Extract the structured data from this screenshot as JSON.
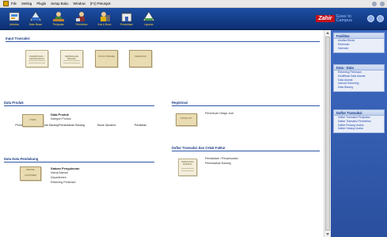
{
  "menubar": {
    "items": [
      "File",
      "Setting",
      "Plugin",
      "Setup Buku",
      "Window",
      "(F1) Petunjuk"
    ]
  },
  "toolbar": {
    "buttons": [
      "Aktivitas",
      "Buku Besar",
      "Penjualan",
      "Pembelian",
      "Kas & Bank",
      "Persediaan",
      "Laporan"
    ],
    "logo_brand": "Zahir",
    "logo_tag_1": "Goes to",
    "logo_tag_2": "Campus"
  },
  "sections": {
    "input_transaksi": "Input Transaksi",
    "data_produk": "Data Produk",
    "registrasi": "Registrasi",
    "daftar_cetak": "Daftar Transaksi dan Cetak Faktur",
    "data_pendukung": "Data Data Pendukung"
  },
  "input_transaksi": {
    "icons": [
      {
        "doc": "PERMINTAAN / PENYESUAIAN",
        "label": "Pemakaian / Penyesuaian Barang"
      },
      {
        "doc": "PEMINDAHAN BARANG",
        "label": "Pemindahan Barang"
      },
      {
        "doc": "STOCK OPNAME",
        "label": "Stock Opname"
      },
      {
        "doc": "PERAKITAN",
        "label": "Perakitan"
      }
    ]
  },
  "data_produk": {
    "doc": "ITEMS",
    "heading": "Data Produk",
    "links": [
      "Kategori Produk"
    ]
  },
  "registrasi": {
    "doc": "PRICE LIST",
    "links": [
      "Penentuan Harga Jual"
    ]
  },
  "daftar_cetak": {
    "doc": "PEMAKAIAN BARANG",
    "links": [
      "Pemakaian / Penyesuaian",
      "Pemindahan Barang"
    ]
  },
  "data_pendukung": {
    "doc": "PROYEK",
    "doc2": "CUSTOMER",
    "heading": "Satuan Pengukuran",
    "links": [
      "Nama Alamat",
      "Departemen",
      "Rekening Perkiraan"
    ]
  },
  "sidebar": {
    "fasilitas": {
      "title": "Fasilitas",
      "links": [
        "Analisa Bisnis",
        "Reminder",
        "Kalender"
      ]
    },
    "data_data": {
      "title": "Data - Data",
      "links": [
        "Rekening Perkiraan",
        "Modifikasi Data Alamat",
        "Data Alamat",
        "Interval Rekening",
        "Data Barang"
      ]
    },
    "daftar_transaksi": {
      "title": "Daftar Transaksi",
      "links": [
        "Daftar Transaksi Penjualan",
        "Daftar Transaksi Pembelian",
        "Daftar Piutang Usaha",
        "Daftar Hutang Usaha"
      ]
    }
  },
  "colors": {
    "toolbar": "#1d4fa3",
    "section_title": "#1f3f86",
    "sidebar": "#3e6cc4",
    "logo": "#c4121a"
  }
}
